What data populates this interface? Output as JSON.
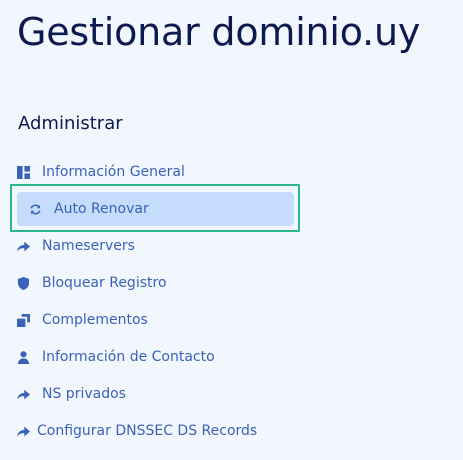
{
  "header": {
    "title": "Gestionar dominio.uy"
  },
  "sidebar": {
    "heading": "Administrar",
    "items": [
      {
        "label": "Información General",
        "icon": "dashboard-icon"
      },
      {
        "label": "Auto Renovar",
        "icon": "sync-icon",
        "active": true
      },
      {
        "label": "Nameservers",
        "icon": "share-arrow-icon"
      },
      {
        "label": "Bloquear Registro",
        "icon": "shield-icon"
      },
      {
        "label": "Complementos",
        "icon": "clone-icon"
      },
      {
        "label": "Información de Contacto",
        "icon": "user-icon"
      },
      {
        "label": "NS privados",
        "icon": "share-arrow-icon"
      },
      {
        "label": "Configurar DNSSEC DS Records",
        "icon": "share-arrow-icon"
      }
    ]
  },
  "colors": {
    "accent": "#3a63b8",
    "active_bg": "#c5dcfd",
    "highlight_border": "#2db58a",
    "title": "#0c1a4f",
    "background": "#f2f6fd"
  }
}
